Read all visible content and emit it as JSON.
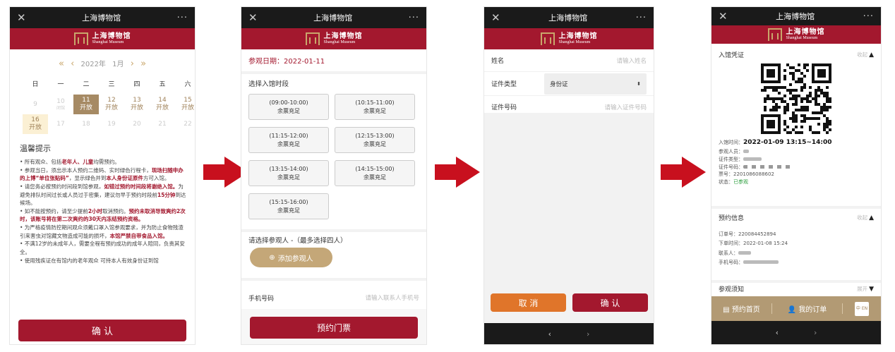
{
  "app": {
    "title": "上海博物馆",
    "logo_cn": "上海博物馆",
    "logo_en": "Shanghai Museum"
  },
  "colors": {
    "brand": "#a3182e",
    "gold": "#a68a64",
    "bar": "#1a1a1a",
    "orange": "#e0752a"
  },
  "p1": {
    "year": "2022年",
    "month": "1月",
    "weekdays": [
      "日",
      "一",
      "二",
      "三",
      "四",
      "五",
      "六"
    ],
    "days": [
      {
        "d": "9",
        "s": "",
        "t": "dis"
      },
      {
        "d": "10",
        "s": "闭馆",
        "t": "dis"
      },
      {
        "d": "11",
        "s": "开放",
        "t": "sel"
      },
      {
        "d": "12",
        "s": "开放",
        "t": ""
      },
      {
        "d": "13",
        "s": "开放",
        "t": ""
      },
      {
        "d": "14",
        "s": "开放",
        "t": ""
      },
      {
        "d": "15",
        "s": "开放",
        "t": ""
      },
      {
        "d": "16",
        "s": "开放",
        "t": "open"
      },
      {
        "d": "17",
        "s": "",
        "t": "dis"
      },
      {
        "d": "18",
        "s": "",
        "t": "dis"
      },
      {
        "d": "19",
        "s": "",
        "t": "dis"
      },
      {
        "d": "20",
        "s": "",
        "t": "dis"
      },
      {
        "d": "21",
        "s": "",
        "t": "dis"
      },
      {
        "d": "22",
        "s": "",
        "t": "dis"
      }
    ],
    "tip_title": "温馨提示",
    "tips": [
      [
        "• 所有观众、包括",
        "老年人、儿童",
        "均需预约。"
      ],
      [
        "• 参观当日，须出示本人预约二维码、实时绿色行程卡，",
        "现场扫随申办的上博“单位张贴码”",
        "，显示绿色并到",
        "本人身份证原件",
        "方可入馆。"
      ],
      [
        "• 请您务必按预约时间段到馆参观，",
        "如错过预约时间段将谢绝入馆。",
        "为避免排队时间过长或人员过于密集，建议勿早于预约时段前",
        "15分钟",
        "到达候场。"
      ],
      [
        "• 如不能按预约，请至少提前",
        "2小时",
        "取消预约。",
        "预约未取消导致爽约2次时，该账号将在第二次爽约的30天内冻结预约资格。",
        ""
      ],
      [
        "• 为严格疫情防控期间观众须戴口罩入馆参观要求，并为防止食物残渣引来害虫对馆藏文物造成可能的损坏，",
        "本馆严禁自带食品入馆。",
        ""
      ],
      [
        "• 不满12岁的未成年人，需要全程有预约成功的成年人陪同，负责其安全。",
        "",
        ""
      ],
      [
        "• 使用残疾证在有馆内的老年观众 可持本人有效身份证到馆",
        "",
        ""
      ]
    ],
    "confirm": "确 认"
  },
  "p2": {
    "date": "参观日期：2022-01-11",
    "slot_label": "选择入馆时段",
    "slots": [
      {
        "time": "(09:00-10:00)",
        "status": "余票充足"
      },
      {
        "time": "(10:15-11:00)",
        "status": "余票充足"
      },
      {
        "time": "(11:15-12:00)",
        "status": "余票充足"
      },
      {
        "time": "(12:15-13:00)",
        "status": "余票充足"
      },
      {
        "time": "(13:15-14:00)",
        "status": "余票充足"
      },
      {
        "time": "(14:15-15:00)",
        "status": "余票充足"
      },
      {
        "time": "(15:15-16:00)",
        "status": "余票充足"
      }
    ],
    "visitor_label": "请选择参观人 -（最多选择四人）",
    "add_visitor": "添加参观人",
    "phone_label": "手机号码",
    "phone_placeholder": "请输入联系人手机号",
    "submit": "预约门票"
  },
  "p3": {
    "name_label": "姓名",
    "name_placeholder": "请输入姓名",
    "idtype_label": "证件类型",
    "idtype_value": "身份证",
    "idno_label": "证件号码",
    "idno_placeholder": "请输入证件号码",
    "cancel": "取 消",
    "confirm": "确 认"
  },
  "p4": {
    "pass_title": "入馆凭证",
    "collapse": "收起",
    "time_label": "入馆时间：",
    "time_value": "2022-01-09 13:15~14:00",
    "visitor_label": "参观人员：",
    "idtype_label": "证件类型：",
    "idno_label": "证件号码：",
    "ticket_label": "票号：",
    "ticket_value": "2201086088602",
    "status_label": "状态：",
    "status_value": "已参观",
    "order_title": "预约信息",
    "order_no_label": "订单号：",
    "order_no": "220084452894",
    "order_time_label": "下单时间：",
    "order_time": "2022-01-08 15:24",
    "contact_label": "联系人：",
    "phone_label": "手机号码：",
    "notice_title": "参观须知",
    "expand": "展开",
    "tab_home": "预约首页",
    "tab_orders": "我的订单",
    "lang": "中 EN"
  }
}
